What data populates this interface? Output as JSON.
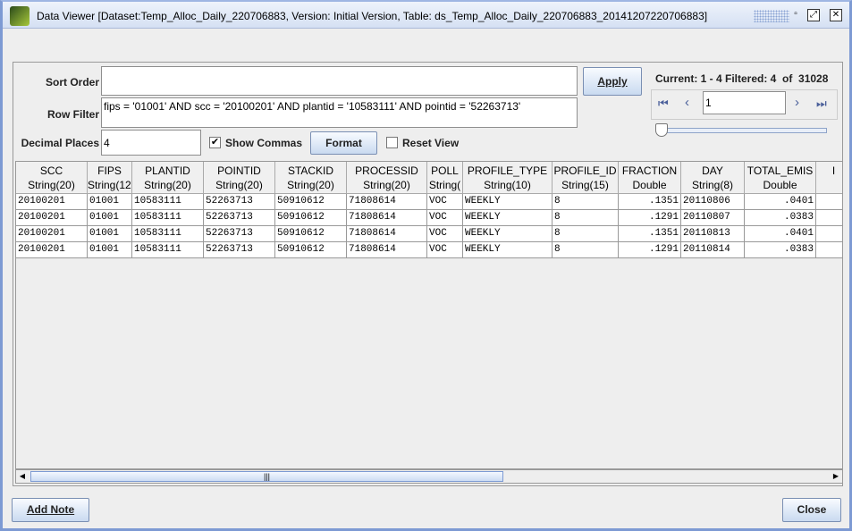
{
  "window": {
    "title": "Data Viewer [Dataset:Temp_Alloc_Daily_220706883, Version: Initial Version, Table: ds_Temp_Alloc_Daily_220706883_20141207220706883]"
  },
  "controls": {
    "sort_order_label": "Sort Order",
    "sort_order_value": "",
    "row_filter_label": "Row Filter",
    "row_filter_value": "fips = '01001' AND scc = '20100201' AND plantid = '10583111' AND pointid = '52263713'",
    "decimal_places_label": "Decimal Places",
    "decimal_places_value": "4",
    "show_commas_label": "Show Commas",
    "show_commas_checked": true,
    "format_label": "Format",
    "reset_view_label": "Reset View",
    "reset_view_checked": false,
    "apply_label": "Apply"
  },
  "paging": {
    "status": "Current: 1 - 4 Filtered: 4  of  31028",
    "page_value": "1",
    "slider_position": 0
  },
  "table": {
    "columns": [
      {
        "name": "SCC",
        "type": "String(20)",
        "align": "left"
      },
      {
        "name": "FIPS",
        "type": "String(12)",
        "align": "left"
      },
      {
        "name": "PLANTID",
        "type": "String(20)",
        "align": "left"
      },
      {
        "name": "POINTID",
        "type": "String(20)",
        "align": "left"
      },
      {
        "name": "STACKID",
        "type": "String(20)",
        "align": "left"
      },
      {
        "name": "PROCESSID",
        "type": "String(20)",
        "align": "left"
      },
      {
        "name": "POLL",
        "type": "String(",
        "align": "left"
      },
      {
        "name": "PROFILE_TYPE",
        "type": "String(10)",
        "align": "left"
      },
      {
        "name": "PROFILE_ID",
        "type": "String(15)",
        "align": "left"
      },
      {
        "name": "FRACTION",
        "type": "Double",
        "align": "right"
      },
      {
        "name": "DAY",
        "type": "String(8)",
        "align": "left"
      },
      {
        "name": "TOTAL_EMIS",
        "type": "Double",
        "align": "right"
      },
      {
        "name": "I",
        "type": "",
        "align": "left"
      }
    ],
    "rows": [
      [
        "20100201",
        "01001",
        "10583111",
        "52263713",
        "50910612",
        "71808614",
        "VOC",
        "WEEKLY",
        "8",
        ".1351",
        "20110806",
        ".0401",
        ""
      ],
      [
        "20100201",
        "01001",
        "10583111",
        "52263713",
        "50910612",
        "71808614",
        "VOC",
        "WEEKLY",
        "8",
        ".1291",
        "20110807",
        ".0383",
        ""
      ],
      [
        "20100201",
        "01001",
        "10583111",
        "52263713",
        "50910612",
        "71808614",
        "VOC",
        "WEEKLY",
        "8",
        ".1351",
        "20110813",
        ".0401",
        ""
      ],
      [
        "20100201",
        "01001",
        "10583111",
        "52263713",
        "50910612",
        "71808614",
        "VOC",
        "WEEKLY",
        "8",
        ".1291",
        "20110814",
        ".0383",
        ""
      ]
    ]
  },
  "footer": {
    "add_note_label": "Add Note",
    "close_label": "Close"
  }
}
